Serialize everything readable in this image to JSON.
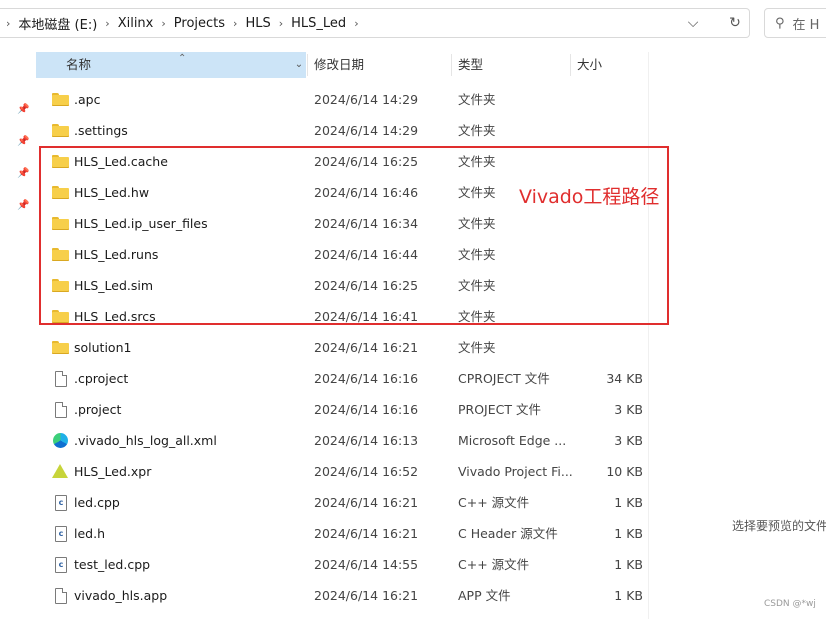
{
  "breadcrumb": [
    "本地磁盘 (E:)",
    "Xilinx",
    "Projects",
    "HLS",
    "HLS_Led"
  ],
  "search": {
    "placeholder": "在 H"
  },
  "columns": {
    "name": "名称",
    "date": "修改日期",
    "type": "类型",
    "size": "大小"
  },
  "files": [
    {
      "name": ".apc",
      "date": "2024/6/14 14:29",
      "type": "文件夹",
      "size": "",
      "icon": "folder-icon"
    },
    {
      "name": ".settings",
      "date": "2024/6/14 14:29",
      "type": "文件夹",
      "size": "",
      "icon": "folder-icon"
    },
    {
      "name": "HLS_Led.cache",
      "date": "2024/6/14 16:25",
      "type": "文件夹",
      "size": "",
      "icon": "folder-icon"
    },
    {
      "name": "HLS_Led.hw",
      "date": "2024/6/14 16:46",
      "type": "文件夹",
      "size": "",
      "icon": "folder-icon"
    },
    {
      "name": "HLS_Led.ip_user_files",
      "date": "2024/6/14 16:34",
      "type": "文件夹",
      "size": "",
      "icon": "folder-icon"
    },
    {
      "name": "HLS_Led.runs",
      "date": "2024/6/14 16:44",
      "type": "文件夹",
      "size": "",
      "icon": "folder-icon"
    },
    {
      "name": "HLS_Led.sim",
      "date": "2024/6/14 16:25",
      "type": "文件夹",
      "size": "",
      "icon": "folder-icon"
    },
    {
      "name": "HLS_Led.srcs",
      "date": "2024/6/14 16:41",
      "type": "文件夹",
      "size": "",
      "icon": "folder-icon"
    },
    {
      "name": "solution1",
      "date": "2024/6/14 16:21",
      "type": "文件夹",
      "size": "",
      "icon": "folder-icon"
    },
    {
      "name": ".cproject",
      "date": "2024/6/14 16:16",
      "type": "CPROJECT 文件",
      "size": "34 KB",
      "icon": "file-icon"
    },
    {
      "name": ".project",
      "date": "2024/6/14 16:16",
      "type": "PROJECT 文件",
      "size": "3 KB",
      "icon": "file-icon"
    },
    {
      "name": ".vivado_hls_log_all.xml",
      "date": "2024/6/14 16:13",
      "type": "Microsoft Edge ...",
      "size": "3 KB",
      "icon": "edge-icon"
    },
    {
      "name": "HLS_Led.xpr",
      "date": "2024/6/14 16:52",
      "type": "Vivado Project Fi...",
      "size": "10 KB",
      "icon": "vivado-icon"
    },
    {
      "name": "led.cpp",
      "date": "2024/6/14 16:21",
      "type": "C++ 源文件",
      "size": "1 KB",
      "icon": "cpp-file-icon"
    },
    {
      "name": "led.h",
      "date": "2024/6/14 16:21",
      "type": "C Header 源文件",
      "size": "1 KB",
      "icon": "c-header-icon"
    },
    {
      "name": "test_led.cpp",
      "date": "2024/6/14 14:55",
      "type": "C++ 源文件",
      "size": "1 KB",
      "icon": "cpp-file-icon"
    },
    {
      "name": "vivado_hls.app",
      "date": "2024/6/14 16:21",
      "type": "APP 文件",
      "size": "1 KB",
      "icon": "file-icon"
    }
  ],
  "annotation": {
    "text": "Vivado工程路径",
    "color": "#e02e2e"
  },
  "preview_message": "选择要预览的文件",
  "watermark": "CSDN @*wj"
}
